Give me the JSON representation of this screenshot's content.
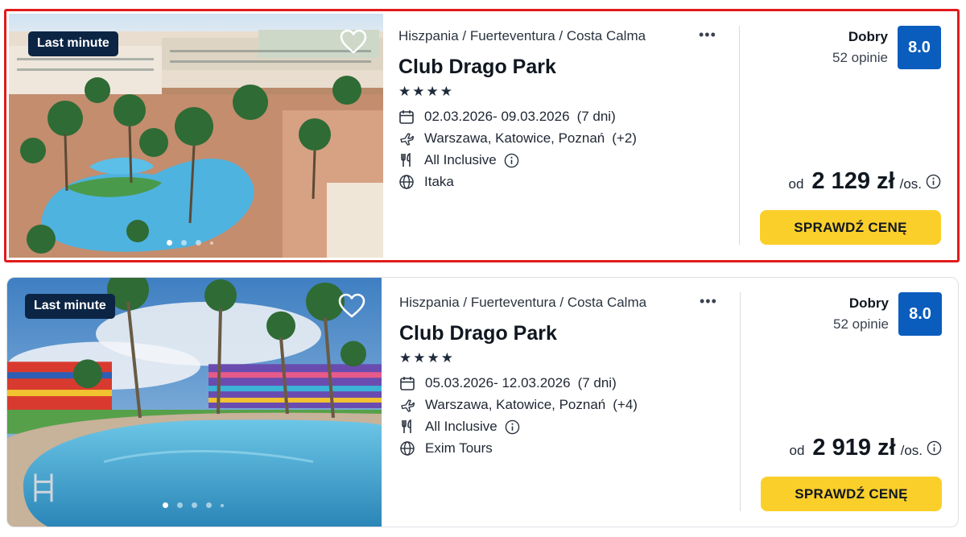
{
  "offers": [
    {
      "badge": "Last minute",
      "breadcrumb": "Hiszpania / Fuerteventura / Costa Calma",
      "more": "•••",
      "hotel_name": "Club Drago Park",
      "stars": "★★★★",
      "dates": "02.03.2026- 09.03.2026",
      "duration": "(7 dni)",
      "departures": "Warszawa, Katowice, Poznań",
      "departures_more": "(+2)",
      "board": "All Inclusive",
      "operator": "Itaka",
      "rating_label": "Dobry",
      "reviews": "52 opinie",
      "score": "8.0",
      "price_prefix": "od",
      "price": "2 129 zł",
      "price_unit": "/os.",
      "cta": "SPRAWDŹ CENĘ"
    },
    {
      "badge": "Last minute",
      "breadcrumb": "Hiszpania / Fuerteventura / Costa Calma",
      "more": "•••",
      "hotel_name": "Club Drago Park",
      "stars": "★★★★",
      "dates": "05.03.2026- 12.03.2026",
      "duration": "(7 dni)",
      "departures": "Warszawa, Katowice, Poznań",
      "departures_more": "(+4)",
      "board": "All Inclusive",
      "operator": "Exim Tours",
      "rating_label": "Dobry",
      "reviews": "52 opinie",
      "score": "8.0",
      "price_prefix": "od",
      "price": "2 919 zł",
      "price_unit": "/os.",
      "cta": "SPRAWDŹ CENĘ"
    }
  ],
  "colors": {
    "badge_bg": "#0c2545",
    "score_bg": "#0a5dbd",
    "cta_bg": "#fbcf2a",
    "highlight_border": "#e11b1b"
  }
}
